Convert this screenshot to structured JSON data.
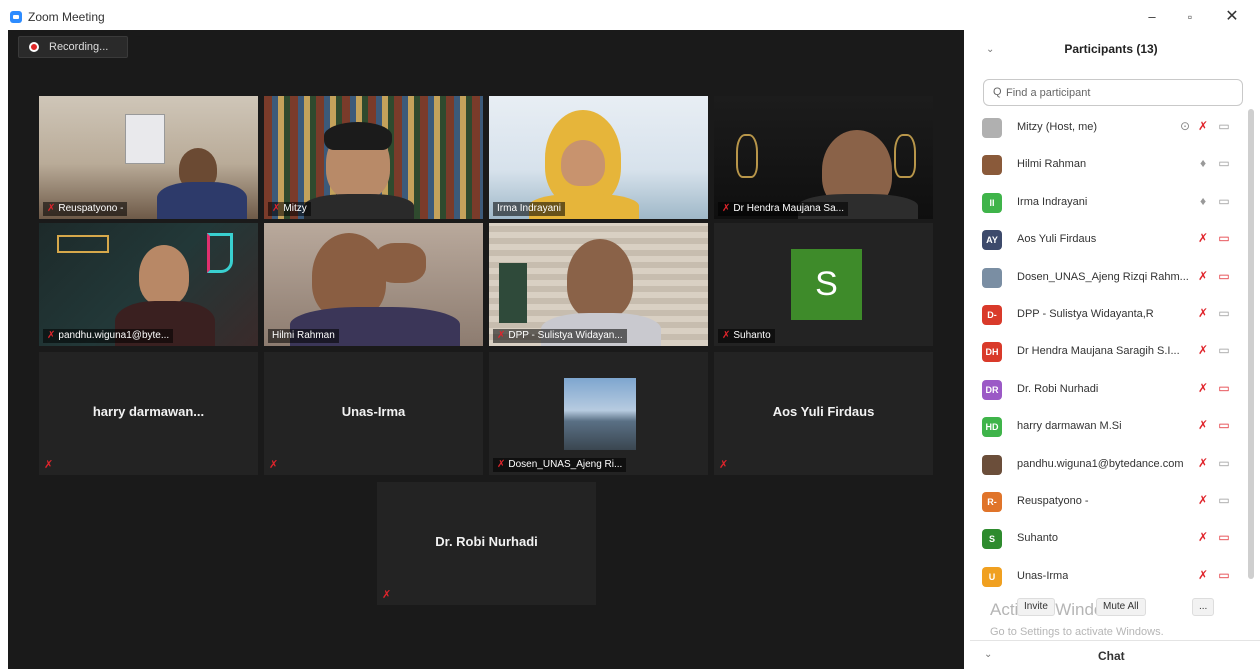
{
  "window": {
    "title": "Zoom Meeting",
    "min": "–",
    "max": "▫",
    "close": "✕"
  },
  "recording": {
    "label": "Recording..."
  },
  "tiles": {
    "t1": "Reuspatyono -",
    "t2": "Mitzy",
    "t3": "Irma Indrayani",
    "t4": "Dr Hendra Maujana Sa...",
    "t5": "pandhu.wiguna1@byte...",
    "t6": "Hilmi Rahman",
    "t7": "DPP - Sulistya Widayan...",
    "t8": "Suhanto",
    "t8_avatar": "S",
    "t9": "harry darmawan...",
    "t10": "Unas-Irma",
    "t11": "Dosen_UNAS_Ajeng Ri...",
    "t12": "Aos Yuli Firdaus",
    "t13": "Dr. Robi Nurhadi"
  },
  "sidebar": {
    "collapse_icon": "⌄",
    "title": "Participants (13)",
    "search_placeholder": "Find a participant",
    "participants": [
      {
        "initials": "",
        "name": "Mitzy (Host, me)",
        "color": "#b0b0b0"
      },
      {
        "initials": "",
        "name": "Hilmi Rahman",
        "color": "#8a5a3a"
      },
      {
        "initials": "II",
        "name": "Irma Indrayani",
        "color": "#3fb44a"
      },
      {
        "initials": "AY",
        "name": "Aos Yuli Firdaus",
        "color": "#3d4a6b"
      },
      {
        "initials": "",
        "name": "Dosen_UNAS_Ajeng Rizqi Rahm...",
        "color": "#7a8ea3"
      },
      {
        "initials": "D-",
        "name": "DPP - Sulistya Widayanta,R",
        "color": "#d93a2a"
      },
      {
        "initials": "DH",
        "name": "Dr Hendra Maujana Saragih S.I...",
        "color": "#d93a2a"
      },
      {
        "initials": "DR",
        "name": "Dr. Robi Nurhadi",
        "color": "#9b59c6"
      },
      {
        "initials": "HD",
        "name": "harry darmawan M.Si",
        "color": "#3fb44a"
      },
      {
        "initials": "",
        "name": "pandhu.wiguna1@bytedance.com",
        "color": "#6b4e3a"
      },
      {
        "initials": "R-",
        "name": "Reuspatyono -",
        "color": "#e0742a"
      },
      {
        "initials": "S",
        "name": "Suhanto",
        "color": "#2e8b2e"
      },
      {
        "initials": "U",
        "name": "Unas-Irma",
        "color": "#f0a020"
      }
    ],
    "invite": "Invite",
    "mute_all": "Mute All",
    "more": "...",
    "chat": "Chat"
  },
  "watermark": {
    "line1": "Activate Windows",
    "line2": "Go to Settings to activate Windows."
  }
}
